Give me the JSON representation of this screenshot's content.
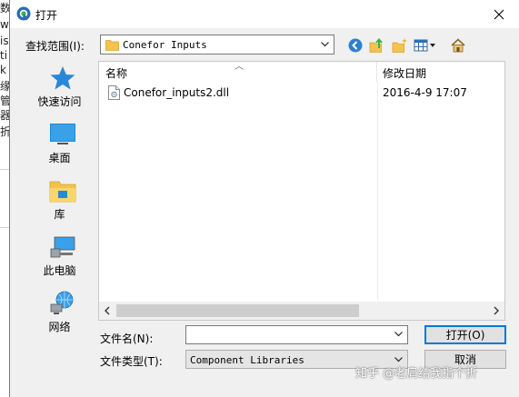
{
  "background_app": {
    "chars": [
      "数",
      "w",
      "is",
      "ti",
      "k",
      "缘",
      "管",
      "器",
      "折"
    ]
  },
  "dialog": {
    "title": "打开",
    "look_in_label": "查找范围(I):",
    "look_in_value": "Conefor Inputs",
    "places": [
      {
        "label": "快速访问",
        "icon": "star-icon"
      },
      {
        "label": "桌面",
        "icon": "desktop-icon"
      },
      {
        "label": "库",
        "icon": "library-icon"
      },
      {
        "label": "此电脑",
        "icon": "computer-icon"
      },
      {
        "label": "网络",
        "icon": "network-icon"
      }
    ],
    "columns": {
      "name": "名称",
      "date": "修改日期"
    },
    "files": [
      {
        "name": "Conefor_inputs2.dll",
        "date": "2016-4-9 17:07"
      }
    ],
    "file_name_label": "文件名(N):",
    "file_name_value": "",
    "file_type_label": "文件类型(T):",
    "file_type_value": "Component Libraries",
    "open_label": "打开(O)",
    "cancel_label": "取消"
  },
  "watermark": "知乎 @老肩结我指个折",
  "colors": {
    "accent": "#0078d7",
    "folder": "#f4c34a",
    "dialog_bg": "#f0f0f0"
  }
}
